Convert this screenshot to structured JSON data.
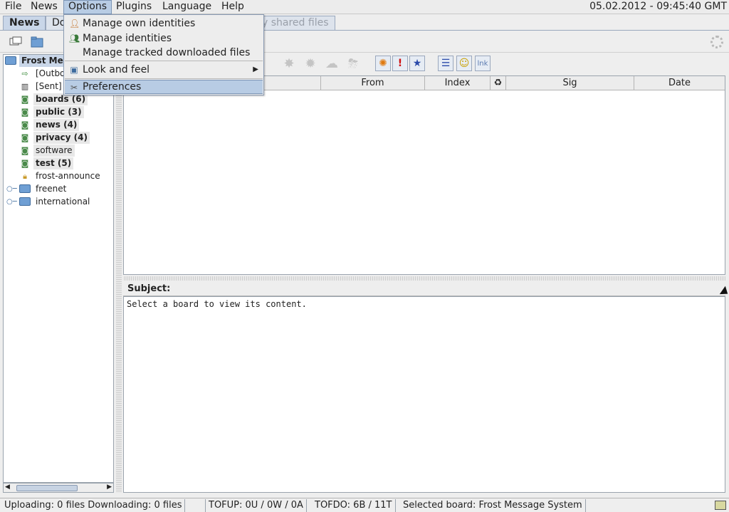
{
  "menubar": {
    "items": [
      "File",
      "News",
      "Options",
      "Plugins",
      "Language",
      "Help"
    ],
    "clock": "05.02.2012 - 09:45:40 GMT"
  },
  "tabs": [
    "News",
    "Do",
    "y shared files"
  ],
  "options_menu": {
    "items": [
      {
        "label": "Manage own identities",
        "icon": "user-icon"
      },
      {
        "label": "Manage identities",
        "icon": "users-icon"
      },
      {
        "label": "Manage tracked downloaded files",
        "icon": ""
      },
      {
        "label": "Look and feel",
        "icon": "look-feel-icon",
        "submenu": true
      },
      {
        "label": "Preferences",
        "icon": "wrench-icon",
        "highlighted": true
      }
    ]
  },
  "tree": {
    "root": "Frost Mes",
    "nodes": [
      {
        "label": "[Outbox",
        "icon": "outbox-icon",
        "bold": false
      },
      {
        "label": "[Sent]",
        "icon": "book-icon",
        "bold": false
      },
      {
        "label": "boards (6)",
        "icon": "board-icon",
        "bold": true
      },
      {
        "label": "public (3)",
        "icon": "board-icon",
        "bold": true
      },
      {
        "label": "news (4)",
        "icon": "board-icon",
        "bold": true
      },
      {
        "label": "privacy (4)",
        "icon": "board-icon",
        "bold": true
      },
      {
        "label": "software",
        "icon": "board-icon",
        "bold": false
      },
      {
        "label": "test (5)",
        "icon": "board-icon",
        "bold": true
      },
      {
        "label": "frost-announce",
        "icon": "lock-icon",
        "bold": false
      },
      {
        "label": "freenet",
        "icon": "folder-icon",
        "bold": false
      },
      {
        "label": "international",
        "icon": "folder-icon",
        "bold": false
      }
    ]
  },
  "table": {
    "columns": [
      "From",
      "Index",
      "♻",
      "Sig",
      "Date"
    ]
  },
  "subject_label": "Subject:",
  "content_text": "Select a board to view its content.",
  "status": {
    "transfers": "Uploading: 0 files  Downloading: 0 files",
    "tofup": "TOFUP: 0U / 0W / 0A",
    "tofdo": "TOFDO: 6B / 11T",
    "selected_board": "Selected board: Frost Message System"
  },
  "toolbar_icons": {
    "link_label": "lnk"
  }
}
